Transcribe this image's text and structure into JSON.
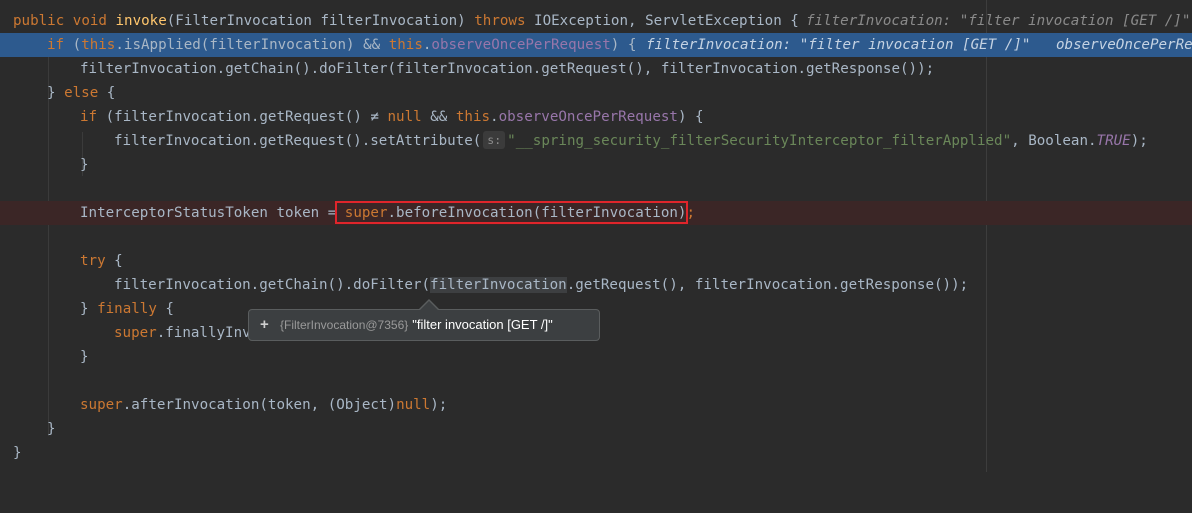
{
  "editor": {
    "lines": [
      {
        "t1": "public",
        "t2": " void ",
        "t3": "invoke",
        "t4": "(FilterInvocation filterInvocation) ",
        "t5": "throws",
        "t6": " IOException, ServletException {",
        "h1": "filterInvocation: \"filter invocation [GET /]\""
      },
      {
        "t1": "if",
        "t2": " (",
        "t3": "this",
        "t4": ".isApplied(filterInvocation) && ",
        "t5": "this",
        "t6": ".",
        "t7": "observeOncePerRequest",
        "t8": ") {",
        "h1": "filterInvocation: \"filter invocation [GET /]\"",
        "h2": "observeOncePerRequest"
      },
      {
        "t1": "filterInvocation.getChain().doFilter(filterInvocation.getRequest(), filterInvocation.getResponse());"
      },
      {
        "t1": "} ",
        "t2": "else",
        "t3": " {"
      },
      {
        "t1": "if",
        "t2": " (filterInvocation.getRequest() ≠ ",
        "t3": "null",
        "t4": " && ",
        "t5": "this",
        "t6": ".",
        "t7": "observeOncePerRequest",
        "t8": ") {"
      },
      {
        "t1": "filterInvocation.getRequest().setAttribute(",
        "p1": "s:",
        "t2": "\"__spring_security_filterSecurityInterceptor_filterApplied\"",
        "t3": ", Boolean.",
        "t4": "TRUE",
        "t5": ");"
      },
      {
        "t1": "}"
      },
      {
        "t1": "InterceptorStatusToken token = ",
        "t2": "super",
        "t3": ".beforeInvocation(filterInvocation)",
        "t4": ";"
      },
      {
        "t1": "try",
        "t2": " {"
      },
      {
        "t1": "filterInvocation.getChain().doFilter(",
        "t2": "filterInvocation",
        "t3": ".getRequest(), filterInvocation.getResponse());"
      },
      {
        "t1": "} ",
        "t2": "finally",
        "t3": " {"
      },
      {
        "t1": "super",
        "t2": ".finallyInv"
      },
      {
        "t1": "}"
      },
      {
        "t1": "super",
        "t2": ".afterInvocation(token, (Object)",
        "t3": "null",
        "t4": ");"
      },
      {
        "t1": "}"
      },
      {
        "t1": "}"
      }
    ]
  },
  "tooltip": {
    "expand": "+",
    "ref": "{FilterInvocation@7356}",
    "value": "\"filter invocation [GET /]\""
  },
  "colors": {
    "background": "#2b2b2b",
    "keyword": "#cc7832",
    "method": "#ffc66d",
    "field": "#9876aa",
    "string": "#6a8759",
    "current_line": "#2d5a8e",
    "breakpoint_line": "#3b2626",
    "annotation_box": "#e0252b"
  }
}
